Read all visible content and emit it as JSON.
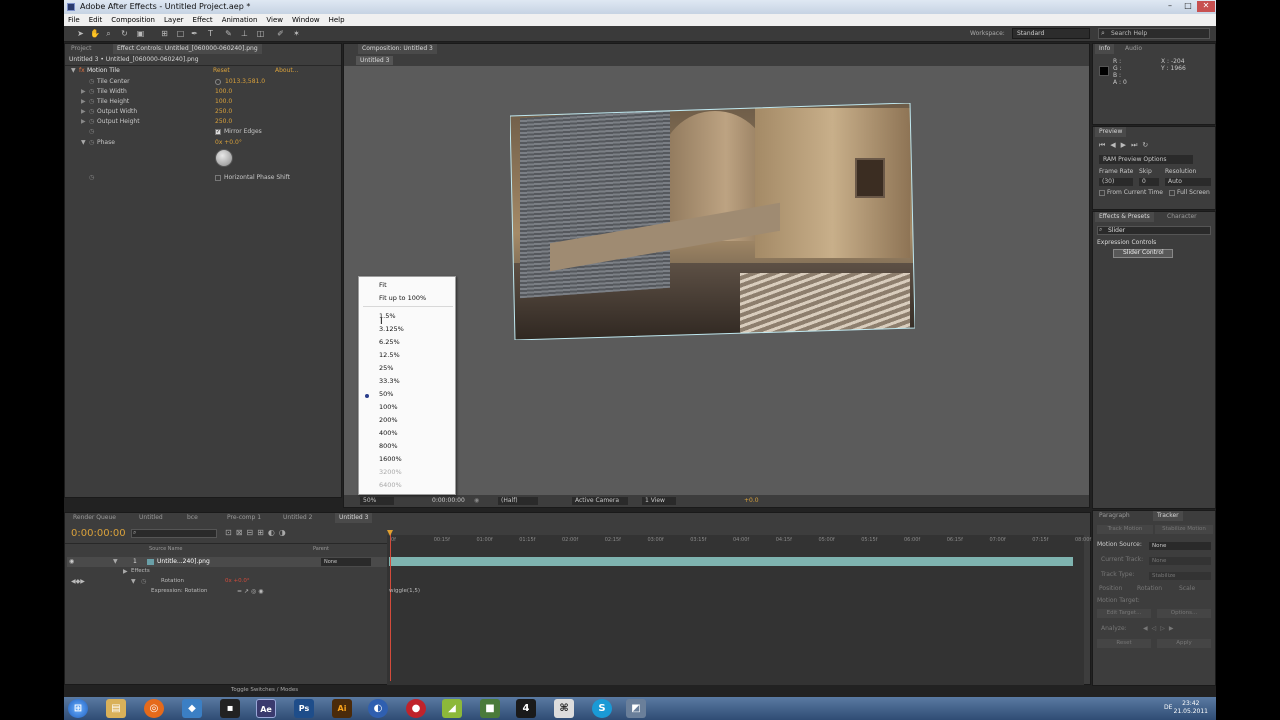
{
  "window": {
    "title": "Adobe After Effects - Untitled Project.aep *",
    "controls": [
      "–",
      "□",
      "✕"
    ]
  },
  "menu": [
    "File",
    "Edit",
    "Composition",
    "Layer",
    "Effect",
    "Animation",
    "View",
    "Window",
    "Help"
  ],
  "toolbar": {
    "workspace_label": "Workspace:",
    "workspace_value": "Standard",
    "search_placeholder": "Search Help"
  },
  "effect_controls": {
    "tabs": [
      "Project",
      "Effect Controls: Untitled_[060000-060240].png"
    ],
    "layer_path": "Untitled 3 • Untitled_[060000-060240].png",
    "effect_name": "Motion Tile",
    "reset": "Reset",
    "about": "About...",
    "params": [
      {
        "name": "Tile Center",
        "value": "1013.3,581.0"
      },
      {
        "name": "Tile Width",
        "value": "100.0"
      },
      {
        "name": "Tile Height",
        "value": "100.0"
      },
      {
        "name": "Output Width",
        "value": "250.0"
      },
      {
        "name": "Output Height",
        "value": "250.0"
      }
    ],
    "mirror_edges": "Mirror Edges",
    "phase_label": "Phase",
    "phase_value": "0x +0.0°",
    "horizontal_phase_shift": "Horizontal Phase Shift"
  },
  "composition": {
    "tab": "Composition: Untitled 3",
    "breadcrumb": "Untitled 3",
    "footer": {
      "zoom": "50%",
      "timecode": "0:00:00:00",
      "resolution": "(Half)",
      "camera": "Active Camera",
      "views": "1 View",
      "exposure": "+0.0"
    }
  },
  "zoom_menu": {
    "items": [
      {
        "label": "Fit",
        "disabled": false
      },
      {
        "label": "Fit up to 100%",
        "disabled": false
      },
      {
        "label": "1.5%",
        "disabled": false
      },
      {
        "label": "3.125%",
        "disabled": false
      },
      {
        "label": "6.25%",
        "disabled": false
      },
      {
        "label": "12.5%",
        "disabled": false
      },
      {
        "label": "25%",
        "disabled": false
      },
      {
        "label": "33.3%",
        "disabled": false
      },
      {
        "label": "50%",
        "disabled": false,
        "selected": true
      },
      {
        "label": "100%",
        "disabled": false
      },
      {
        "label": "200%",
        "disabled": false
      },
      {
        "label": "400%",
        "disabled": false
      },
      {
        "label": "800%",
        "disabled": false
      },
      {
        "label": "1600%",
        "disabled": false
      },
      {
        "label": "3200%",
        "disabled": true
      },
      {
        "label": "6400%",
        "disabled": true
      }
    ]
  },
  "info_panel": {
    "tabs": [
      "Info",
      "Audio"
    ],
    "r": "R :",
    "g": "G :",
    "b": "B :",
    "a": "A : 0",
    "x": "X : -204",
    "y": "Y : 1966"
  },
  "preview_panel": {
    "title": "Preview",
    "ram_options": "RAM Preview Options",
    "frame_rate_label": "Frame Rate",
    "frame_rate_value": "(30)",
    "skip_label": "Skip",
    "skip_value": "0",
    "resolution_label": "Resolution",
    "resolution_value": "Auto",
    "from_current_time": "From Current Time",
    "full_screen": "Full Screen"
  },
  "effects_presets": {
    "tabs": [
      "Effects & Presets",
      "Character"
    ],
    "search_value": "Slider",
    "category": "Expression Controls",
    "item": "Slider Control"
  },
  "timeline": {
    "tabs": [
      "Render Queue",
      "Untitled",
      "bce",
      "Pre-comp 1",
      "Untitled 2",
      "Untitled 3"
    ],
    "timecode": "0:00:00:00",
    "source_name_header": "Source Name",
    "parent_header": "Parent",
    "layer_number": "1",
    "layer_name": "Untitle...240].png",
    "parent_value": "None",
    "effects_label": "Effects",
    "rotation_label": "Rotation",
    "rotation_value": "0x +0.0°",
    "expression_label": "Expression: Rotation",
    "expression_text": "wiggle(1,5)",
    "ruler": [
      "0f",
      "00:15f",
      "01:00f",
      "01:15f",
      "02:00f",
      "02:15f",
      "03:00f",
      "03:15f",
      "04:00f",
      "04:15f",
      "05:00f",
      "05:15f",
      "06:00f",
      "06:15f",
      "07:00f",
      "07:15f",
      "08:00f"
    ],
    "toggle_label": "Toggle Switches / Modes"
  },
  "paragraph_tracker": {
    "tabs": [
      "Paragraph",
      "Tracker"
    ],
    "buttons": [
      "Track Motion",
      "Stabilize Motion"
    ],
    "motion_source_label": "Motion Source:",
    "motion_source_value": "None",
    "current_track_label": "Current Track:",
    "current_track_value": "None",
    "track_type_label": "Track Type:",
    "track_type_value": "Stabilize",
    "options": [
      "Position",
      "Rotation",
      "Scale"
    ],
    "motion_target": "Motion Target:",
    "edit_target": "Edit Target...",
    "options_btn": "Options...",
    "analyze": "Analyze:",
    "reset": "Reset",
    "apply": "Apply"
  },
  "taskbar": {
    "apps": [
      "start-orb",
      "explorer",
      "firefox",
      "app3",
      "cmd",
      "after-effects",
      "photoshop",
      "illustrator",
      "app9",
      "app10",
      "app11",
      "app12",
      "app13",
      "app14",
      "skype",
      "app16"
    ],
    "language": "DE",
    "time": "23:42",
    "date": "21.05.2011"
  },
  "colors": {
    "panel_bg": "#3d3d3d",
    "accent_orange": "#d9a13b",
    "track_bar": "#7fb4b0",
    "playhead": "#d34b3b",
    "taskbar": "#3a5a86"
  }
}
